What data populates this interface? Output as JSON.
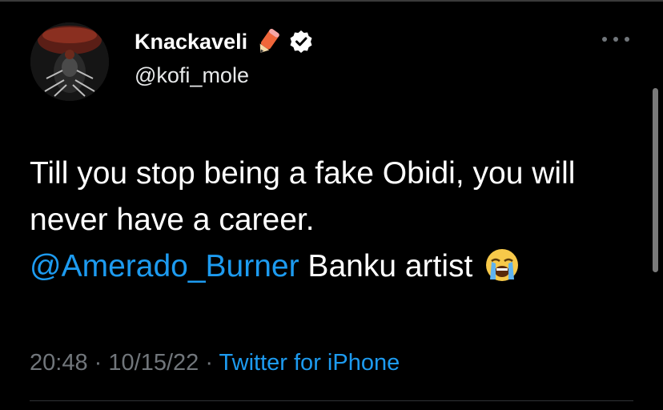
{
  "tweet": {
    "display_name": "Knackaveli",
    "handle": "@kofi_mole",
    "body_text_1": "Till you stop being a fake Obidi, you will never have a career.",
    "mention": "@Amerado_Burner",
    "body_text_2": " Banku artist",
    "time": "20:48",
    "separator": "·",
    "date": "10/15/22",
    "source": "Twitter for iPhone"
  },
  "icons": {
    "name_emoji": "pencil-emoji-icon",
    "verified": "verified-badge-icon",
    "more": "more-options-icon",
    "reaction_emoji": "loudly-crying-face-icon"
  },
  "colors": {
    "background": "#000000",
    "text": "#ffffff",
    "secondary_text": "#71767b",
    "link": "#1d9bf0"
  }
}
